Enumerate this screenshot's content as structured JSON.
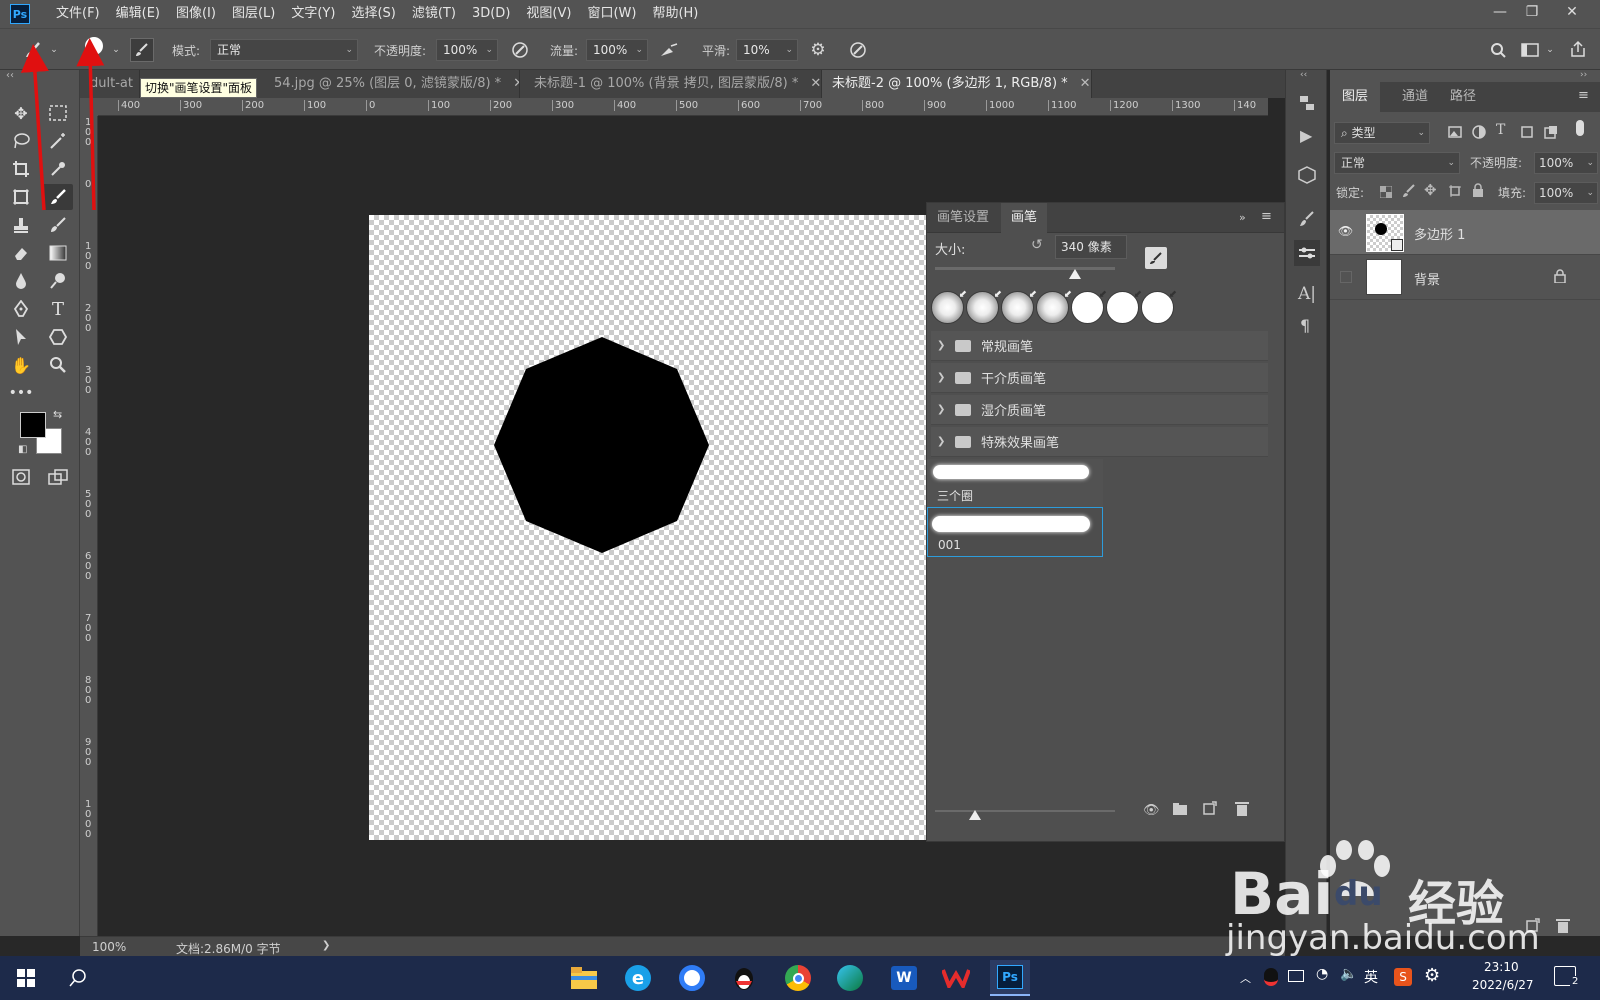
{
  "app": {
    "logo": "Ps",
    "accent": "#31a8ff"
  },
  "menubar": {
    "items": [
      "文件(F)",
      "编辑(E)",
      "图像(I)",
      "图层(L)",
      "文字(Y)",
      "选择(S)",
      "滤镜(T)",
      "3D(D)",
      "视图(V)",
      "窗口(W)",
      "帮助(H)"
    ]
  },
  "options": {
    "brush_size": "340",
    "mode_label": "模式:",
    "mode_value": "正常",
    "opacity_label": "不透明度:",
    "opacity_value": "100%",
    "flow_label": "流量:",
    "flow_value": "100%",
    "smooth_label": "平滑:",
    "smooth_value": "10%"
  },
  "tooltip": "切换\"画笔设置\"面板",
  "tabs": [
    {
      "label": "dult-at",
      "active": false
    },
    {
      "label": "54.jpg  @  25% (图层 0, 滤镜蒙版/8) *",
      "active": false
    },
    {
      "label": "未标题-1 @ 100% (背景 拷贝, 图层蒙版/8) *",
      "active": false
    },
    {
      "label": "未标题-2 @ 100% (多边形 1, RGB/8) *",
      "active": true
    }
  ],
  "ruler_h": [
    "400",
    "300",
    "200",
    "100",
    "0",
    "100",
    "200",
    "300",
    "400",
    "500",
    "600",
    "700",
    "800",
    "900",
    "1000",
    "1100",
    "1200",
    "1300",
    "140"
  ],
  "ruler_v": [
    "1\n0\n0",
    "0",
    "1\n0\n0",
    "2\n0\n0",
    "3\n0\n0",
    "4\n0\n0",
    "5\n0\n0",
    "6\n0\n0",
    "7\n0\n0",
    "8\n0\n0",
    "9\n0\n0",
    "1\n0\n0\n0"
  ],
  "status": {
    "zoom": "100%",
    "doc": "文档:2.86M/0 字节",
    "arrow": "❯"
  },
  "brush_panel": {
    "tabs": [
      "画笔设置",
      "画笔"
    ],
    "active_tab": "画笔",
    "size_label": "大小:",
    "size_value": "340 像素",
    "size_fraction": 0.78,
    "folders": [
      "常规画笔",
      "干介质画笔",
      "湿介质画笔",
      "特殊效果画笔"
    ],
    "presets": [
      {
        "name": "三个圈",
        "selected": false
      },
      {
        "name": "001",
        "selected": true
      }
    ],
    "bottom_slider_fraction": 0.22
  },
  "layers_panel": {
    "tabs": [
      "图层",
      "通道",
      "路径"
    ],
    "active_tab": "图层",
    "filter_label": "类型",
    "blend_mode": "正常",
    "opacity_label": "不透明度:",
    "opacity_value": "100%",
    "lock_label": "锁定:",
    "fill_label": "填充:",
    "fill_value": "100%",
    "layers": [
      {
        "name": "多边形 1",
        "selected": true,
        "visible": true
      },
      {
        "name": "背景",
        "selected": false,
        "visible": false
      }
    ]
  },
  "taskbar": {
    "ime": "英",
    "time": "23:10",
    "date": "2022/6/27",
    "notification_count": "2",
    "ps_label": "Ps",
    "word_label": "W"
  },
  "watermark": {
    "brand": "Bai",
    "brand2": "du",
    "cn": "经验",
    "url": "jingyan.baidu.com"
  }
}
